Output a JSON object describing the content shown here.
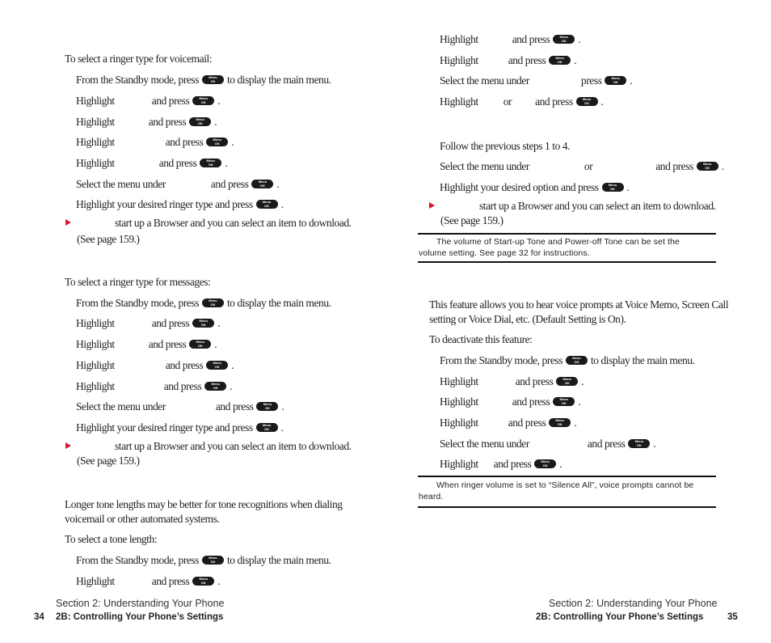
{
  "left_page": {
    "voicemail": {
      "intro": "To select a ringer type for voicemail:",
      "step1_a": "From the Standby mode, press",
      "step1_b": "to display the main menu.",
      "step2_a": "Highlight",
      "step2_b": "and press",
      "step3_a": "Highlight",
      "step3_b": "and press",
      "step4_a": "Highlight",
      "step4_b": "and press",
      "step5_a": "Highlight",
      "step5_b": "and press",
      "step6_a": "Select the menu under",
      "step6_b": "and press",
      "step7_a": "Highlight your desired ringer type and press",
      "tip_a": "start up a Browser and you can select an item to download.",
      "tip_b": "(See page 159.)"
    },
    "messages": {
      "intro": "To select a ringer type for messages:",
      "step1_a": "From the Standby mode, press",
      "step1_b": "to display the main menu.",
      "step2_a": "Highlight",
      "step2_b": "and press",
      "step3_a": "Highlight",
      "step3_b": "and press",
      "step4_a": "Highlight",
      "step4_b": "and press",
      "step5_a": "Highlight",
      "step5_b": "and press",
      "step6_a": "Select the menu under",
      "step6_b": "and press",
      "step7_a": "Highlight your desired ringer type and press",
      "tip_a": "start up a Browser and you can select an item to download.",
      "tip_b": "(See page 159.)"
    },
    "tone_length": {
      "para_a": "Longer tone lengths may be better for tone recognitions when dialing",
      "para_b": "voicemail or other automated systems.",
      "intro": "To select a tone length:",
      "step1_a": "From the Standby mode, press",
      "step1_b": "to display the main menu.",
      "step2_a": "Highlight",
      "step2_b": "and press"
    },
    "footer": {
      "section": "Section 2: Understanding Your Phone",
      "page_number": "34",
      "chapter": "2B: Controlling Your Phone’s Settings"
    }
  },
  "right_page": {
    "top_steps": {
      "step1_a": "Highlight",
      "step1_b": "and press",
      "step2_a": "Highlight",
      "step2_b": "and press",
      "step3_a": "Select the menu under",
      "step3_b": "press",
      "step4_a": "Highlight",
      "step4_or": "or",
      "step4_b": "and press"
    },
    "second_steps": {
      "step1": "Follow the previous steps 1 to 4.",
      "step2_a": "Select the menu under",
      "step2_or": "or",
      "step2_b": "and press",
      "step3_a": "Highlight your desired option and press",
      "tip_a": "start up a Browser and you can select an item to download.",
      "tip_b": "(See page 159.)"
    },
    "note1": {
      "line1": "The volume of Start-up Tone and Power-off Tone can be set the",
      "line2": "volume setting. See page 32 for instructions."
    },
    "voice_prompt": {
      "para_a": "This feature allows you to hear voice prompts at Voice Memo, Screen Call",
      "para_b": "setting or Voice Dial, etc. (Default Setting is On).",
      "intro": "To deactivate this feature:",
      "step1_a": "From the Standby mode, press",
      "step1_b": "to display the main menu.",
      "step2_a": "Highlight",
      "step2_b": "and press",
      "step3_a": "Highlight",
      "step3_b": "and press",
      "step4_a": "Highlight",
      "step4_b": "and press",
      "step5_a": "Select the menu under",
      "step5_b": "and press",
      "step6_a": "Highlight",
      "step6_b": "and press"
    },
    "note2": {
      "line1": "When ringer volume is set to “Silence All”, voice prompts cannot be",
      "line2": "heard."
    },
    "footer": {
      "section": "Section 2: Understanding Your Phone",
      "chapter": "2B: Controlling Your Phone’s Settings",
      "page_number": "35"
    }
  },
  "icons": {
    "menu_ok_key": "menu-ok-button-icon",
    "tip_arrow": "red-triangle-icon"
  },
  "colors": {
    "tip_arrow": "#d7192a",
    "key": "#1a1a1a",
    "rule": "#111111"
  }
}
